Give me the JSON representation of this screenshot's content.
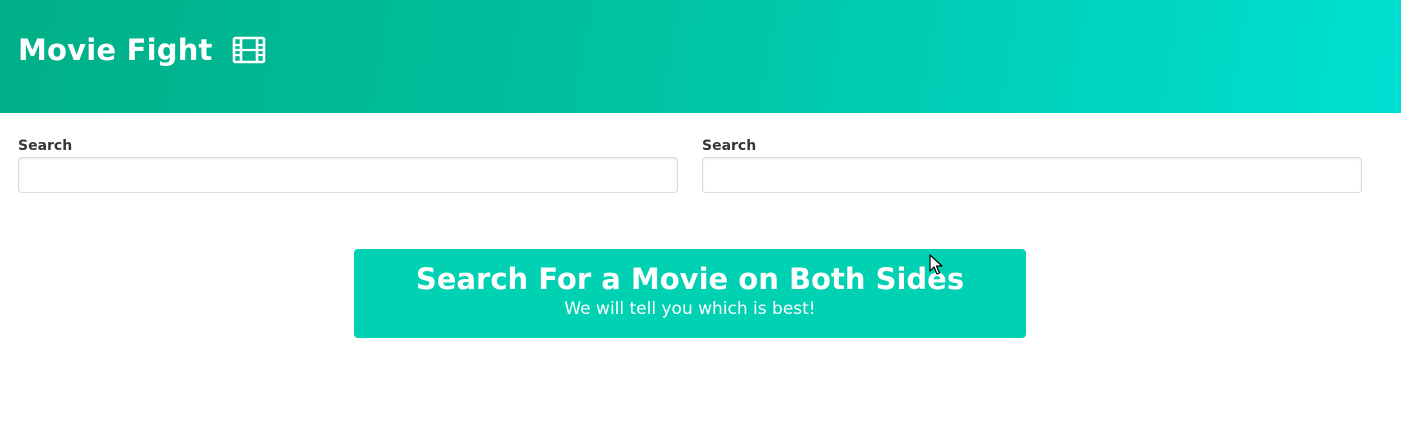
{
  "header": {
    "title": "Movie Fight",
    "icon": "film-icon"
  },
  "search": {
    "left": {
      "label": "Search",
      "value": "",
      "placeholder": ""
    },
    "right": {
      "label": "Search",
      "value": "",
      "placeholder": ""
    }
  },
  "tutorial": {
    "title": "Search For a Movie on Both Sides",
    "subtitle": "We will tell you which is best!"
  },
  "colors": {
    "accent": "#00d1b2",
    "hero_start": "#00af87",
    "hero_end": "#00e0d2"
  }
}
